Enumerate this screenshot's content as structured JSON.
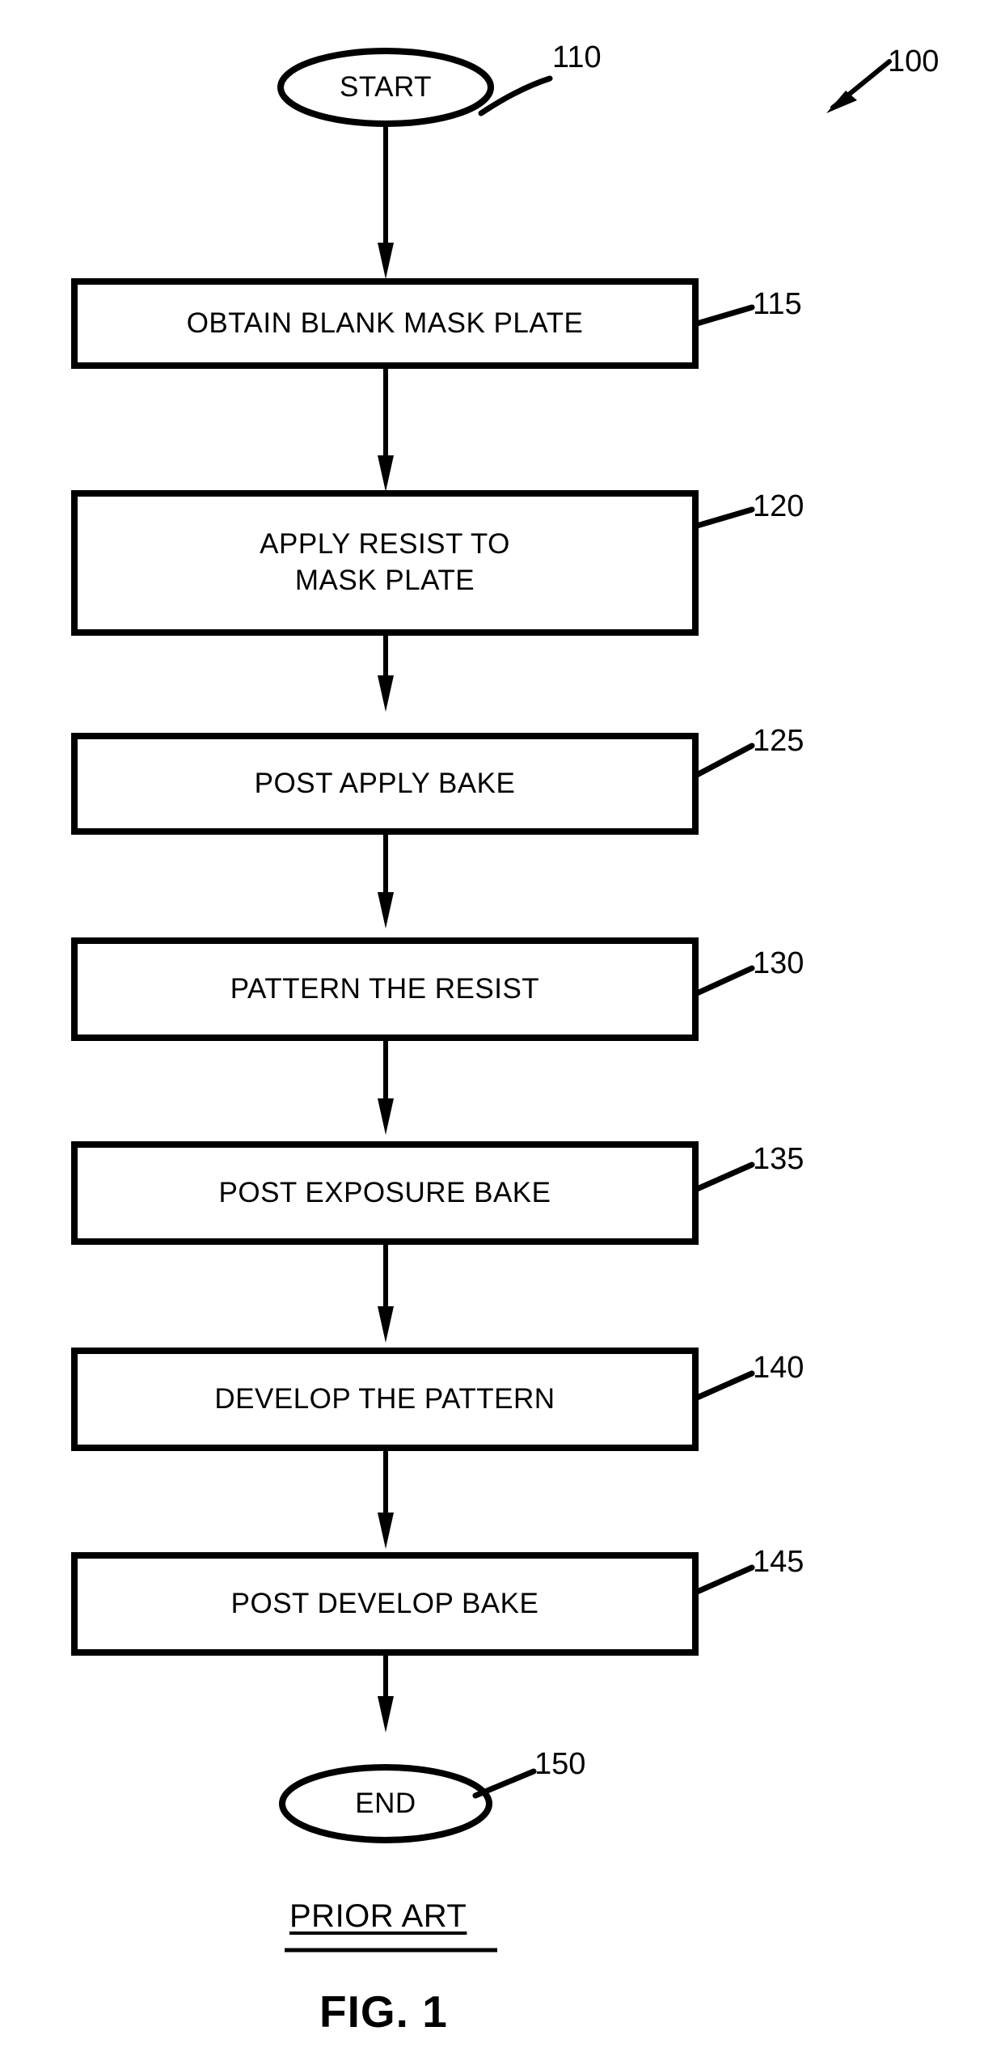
{
  "figure": {
    "caption_prior_art": "PRIOR ART",
    "caption_figure": "FIG. 1",
    "overall_ref": "100",
    "ink_color": "#000000",
    "background_color": "#ffffff"
  },
  "flowchart": {
    "nodes": [
      {
        "id": "start",
        "shape": "ellipse",
        "label": "START",
        "ref": "110"
      },
      {
        "id": "step115",
        "shape": "rectangle",
        "label": "OBTAIN BLANK MASK PLATE",
        "ref": "115"
      },
      {
        "id": "step120",
        "shape": "rectangle",
        "label": "APPLY RESIST TO\nMASK PLATE",
        "ref": "120"
      },
      {
        "id": "step125",
        "shape": "rectangle",
        "label": "POST APPLY BAKE",
        "ref": "125"
      },
      {
        "id": "step130",
        "shape": "rectangle",
        "label": "PATTERN THE RESIST",
        "ref": "130"
      },
      {
        "id": "step135",
        "shape": "rectangle",
        "label": "POST EXPOSURE BAKE",
        "ref": "135"
      },
      {
        "id": "step140",
        "shape": "rectangle",
        "label": "DEVELOP THE PATTERN",
        "ref": "140"
      },
      {
        "id": "step145",
        "shape": "rectangle",
        "label": "POST DEVELOP BAKE",
        "ref": "145"
      },
      {
        "id": "end",
        "shape": "ellipse",
        "label": "END",
        "ref": "150"
      }
    ],
    "edges": [
      {
        "from": "start",
        "to": "step115"
      },
      {
        "from": "step115",
        "to": "step120"
      },
      {
        "from": "step120",
        "to": "step125"
      },
      {
        "from": "step125",
        "to": "step130"
      },
      {
        "from": "step130",
        "to": "step135"
      },
      {
        "from": "step135",
        "to": "step140"
      },
      {
        "from": "step140",
        "to": "step145"
      },
      {
        "from": "step145",
        "to": "end"
      }
    ]
  }
}
